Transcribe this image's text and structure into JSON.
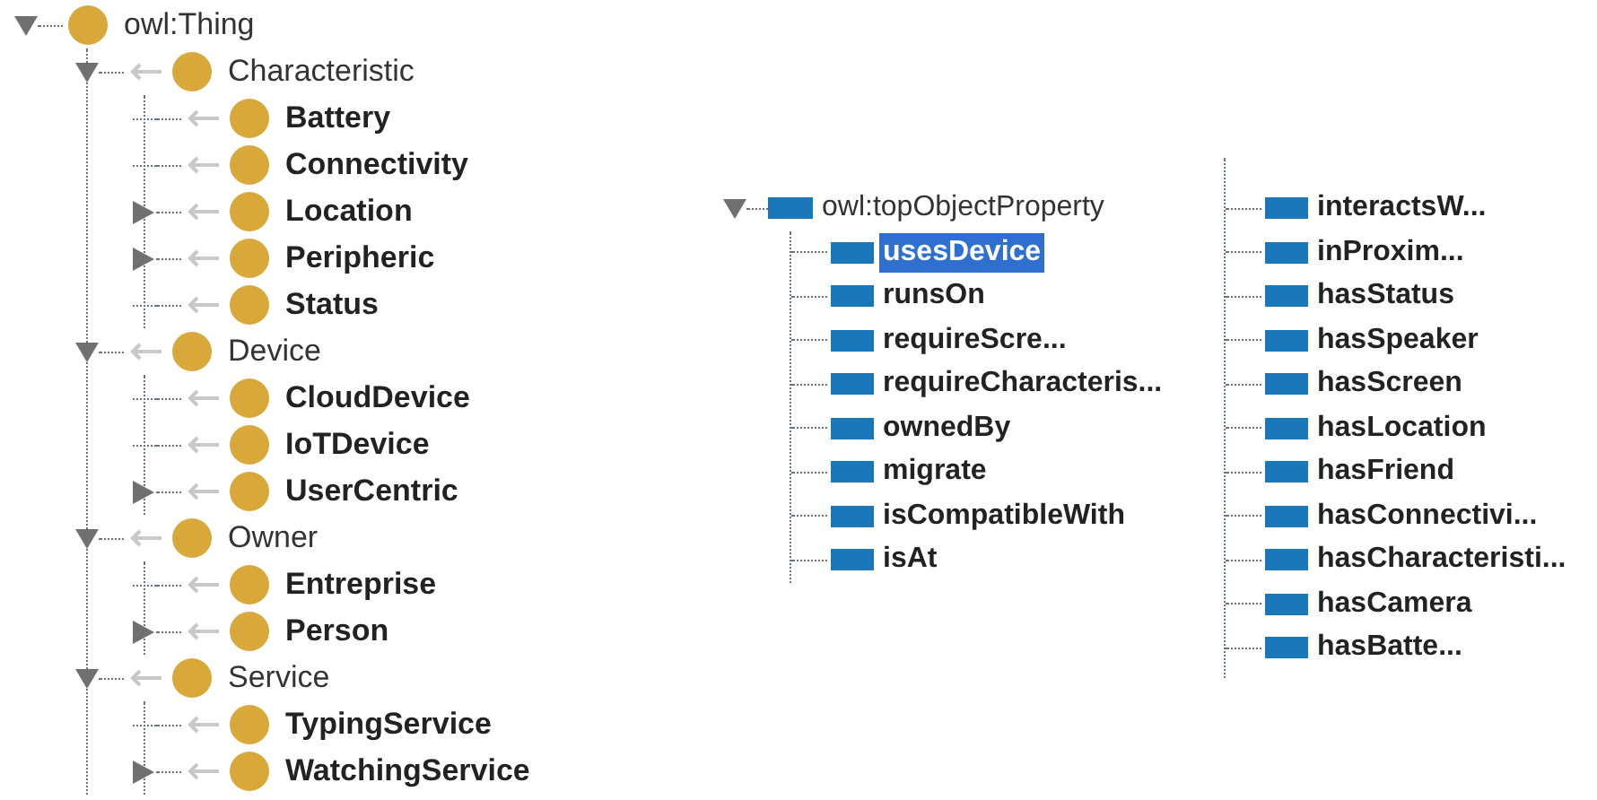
{
  "class_tree": {
    "label": "owl:Thing",
    "kind": "expanded",
    "children": [
      {
        "label": "Characteristic",
        "kind": "expanded",
        "children": [
          {
            "label": "Battery",
            "kind": "leaf"
          },
          {
            "label": "Connectivity",
            "kind": "leaf"
          },
          {
            "label": "Location",
            "kind": "collapsed"
          },
          {
            "label": "Peripheric",
            "kind": "collapsed"
          },
          {
            "label": "Status",
            "kind": "leaf"
          }
        ]
      },
      {
        "label": "Device",
        "kind": "expanded",
        "children": [
          {
            "label": "CloudDevice",
            "kind": "leaf"
          },
          {
            "label": "IoTDevice",
            "kind": "leaf"
          },
          {
            "label": "UserCentric",
            "kind": "collapsed"
          }
        ]
      },
      {
        "label": "Owner",
        "kind": "expanded",
        "children": [
          {
            "label": "Entreprise",
            "kind": "leaf"
          },
          {
            "label": "Person",
            "kind": "collapsed"
          }
        ]
      },
      {
        "label": "Service",
        "kind": "expanded",
        "children": [
          {
            "label": "TypingService",
            "kind": "leaf"
          },
          {
            "label": "WatchingService",
            "kind": "collapsed"
          }
        ]
      }
    ]
  },
  "property_tree": {
    "label": "owl:topObjectProperty",
    "kind": "expanded",
    "columns": [
      [
        {
          "label": "usesDevice",
          "selected": true
        },
        {
          "label": "runsOn",
          "selected": false
        },
        {
          "label": "requireScre...",
          "selected": false
        },
        {
          "label": "requireCharacteris...",
          "selected": false
        },
        {
          "label": "ownedBy",
          "selected": false
        },
        {
          "label": "migrate",
          "selected": false
        },
        {
          "label": "isCompatibleWith",
          "selected": false
        },
        {
          "label": "isAt",
          "selected": false
        }
      ],
      [
        {
          "label": "interactsW...",
          "selected": false
        },
        {
          "label": "inProxim...",
          "selected": false
        },
        {
          "label": "hasStatus",
          "selected": false
        },
        {
          "label": "hasSpeaker",
          "selected": false
        },
        {
          "label": "hasScreen",
          "selected": false
        },
        {
          "label": "hasLocation",
          "selected": false
        },
        {
          "label": "hasFriend",
          "selected": false
        },
        {
          "label": "hasConnectivi...",
          "selected": false
        },
        {
          "label": "hasCharacteristi...",
          "selected": false
        },
        {
          "label": "hasCamera",
          "selected": false
        },
        {
          "label": "hasBatte...",
          "selected": false
        }
      ]
    ]
  }
}
